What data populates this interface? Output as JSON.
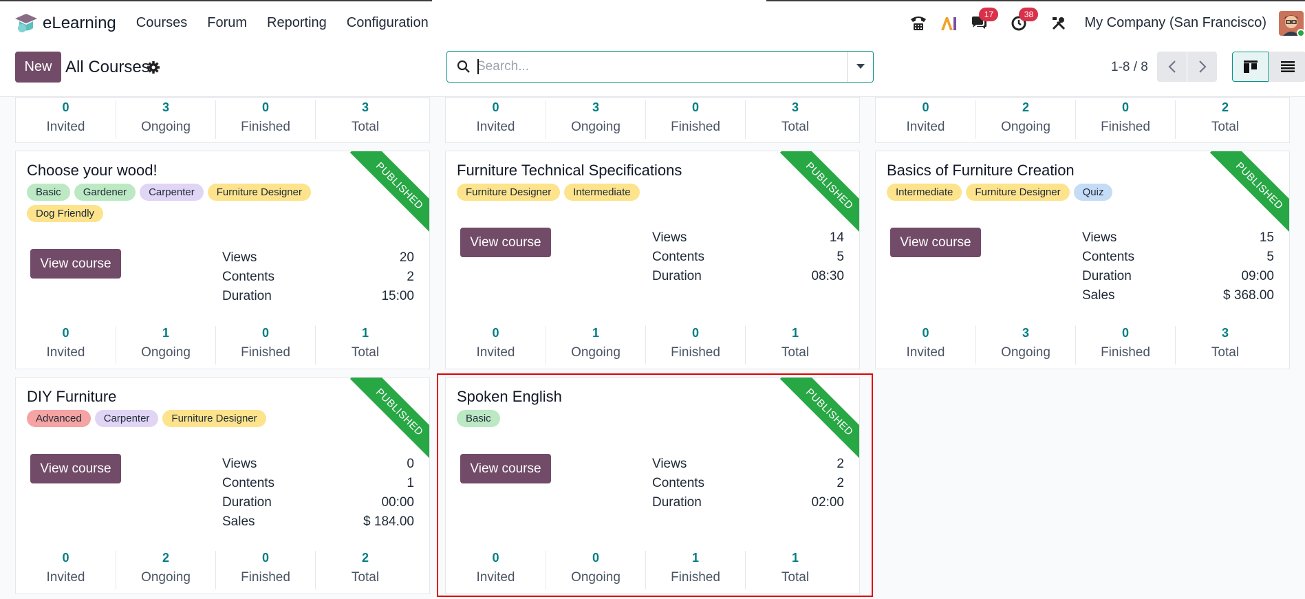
{
  "app": {
    "name": "eLearning"
  },
  "menu": [
    "Courses",
    "Forum",
    "Reporting",
    "Configuration"
  ],
  "systray": {
    "messages_count": "17",
    "activities_count": "38",
    "company": "My Company (San Francisco)"
  },
  "control": {
    "new_label": "New",
    "title": "All Courses",
    "search_placeholder": "Search...",
    "pager": "1-8 / 8"
  },
  "partial_cards": [
    {
      "invited": "0",
      "ongoing": "3",
      "finished": "0",
      "total": "3"
    },
    {
      "invited": "0",
      "ongoing": "3",
      "finished": "0",
      "total": "3"
    },
    {
      "invited": "0",
      "ongoing": "2",
      "finished": "0",
      "total": "2"
    }
  ],
  "labels": {
    "view_course": "View course",
    "views": "Views",
    "contents": "Contents",
    "duration": "Duration",
    "sales": "Sales",
    "invited": "Invited",
    "ongoing": "Ongoing",
    "finished": "Finished",
    "total": "Total",
    "published": "PUBLISHED"
  },
  "courses": [
    {
      "title": "Choose your wood!",
      "tags": [
        {
          "label": "Basic",
          "color": "#bce9c4"
        },
        {
          "label": "Gardener",
          "color": "#bce9c4"
        },
        {
          "label": "Carpenter",
          "color": "#e1d5f6"
        },
        {
          "label": "Furniture Designer",
          "color": "#fde38b"
        },
        {
          "label": "Dog Friendly",
          "color": "#fde38b"
        }
      ],
      "views": "20",
      "contents": "2",
      "duration": "15:00",
      "sales": "",
      "invited": "0",
      "ongoing": "1",
      "finished": "0",
      "total": "1"
    },
    {
      "title": "Furniture Technical Specifications",
      "tags": [
        {
          "label": "Furniture Designer",
          "color": "#fde38b"
        },
        {
          "label": "Intermediate",
          "color": "#fde38b"
        }
      ],
      "views": "14",
      "contents": "5",
      "duration": "08:30",
      "sales": "",
      "invited": "0",
      "ongoing": "1",
      "finished": "0",
      "total": "1"
    },
    {
      "title": "Basics of Furniture Creation",
      "tags": [
        {
          "label": "Intermediate",
          "color": "#fde38b"
        },
        {
          "label": "Furniture Designer",
          "color": "#fde38b"
        },
        {
          "label": "Quiz",
          "color": "#c5dcf6"
        }
      ],
      "views": "15",
      "contents": "5",
      "duration": "09:00",
      "sales": "$ 368.00",
      "invited": "0",
      "ongoing": "3",
      "finished": "0",
      "total": "3"
    },
    {
      "title": "DIY Furniture",
      "tags": [
        {
          "label": "Advanced",
          "color": "#f5a3a3"
        },
        {
          "label": "Carpenter",
          "color": "#e1d5f6"
        },
        {
          "label": "Furniture Designer",
          "color": "#fde38b"
        }
      ],
      "views": "0",
      "contents": "1",
      "duration": "00:00",
      "sales": "$ 184.00",
      "invited": "0",
      "ongoing": "2",
      "finished": "0",
      "total": "2"
    },
    {
      "title": "Spoken English",
      "tags": [
        {
          "label": "Basic",
          "color": "#bce9c4"
        }
      ],
      "views": "2",
      "contents": "2",
      "duration": "02:00",
      "sales": "",
      "invited": "0",
      "ongoing": "0",
      "finished": "1",
      "total": "1"
    }
  ]
}
